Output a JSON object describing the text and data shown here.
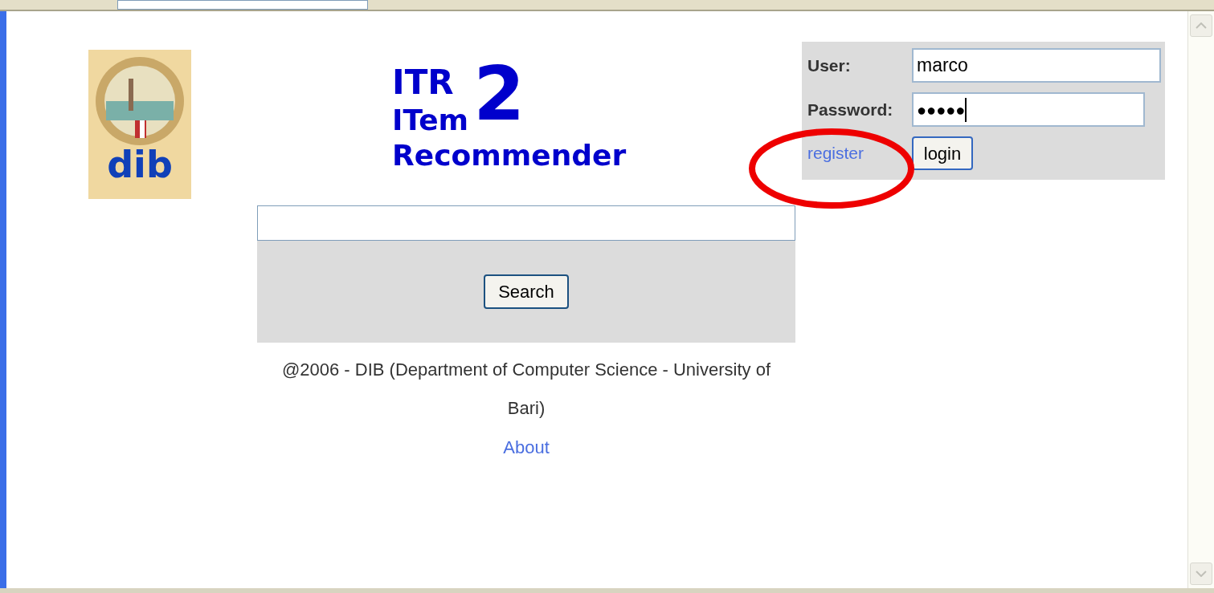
{
  "logo": {
    "text": "dib"
  },
  "title": {
    "line_1": "ITR",
    "line_2": "ITem",
    "line_3": "Recommender",
    "version": "2"
  },
  "login": {
    "user_label": "User:",
    "user_value": "marco",
    "password_label": "Password:",
    "password_value": "●●●●●",
    "register_link": "register",
    "login_button": "login"
  },
  "search": {
    "button": "Search"
  },
  "footer": {
    "copyright": "@2006 - DIB (Department of Computer Science - University of Bari)",
    "about_link": "About"
  }
}
